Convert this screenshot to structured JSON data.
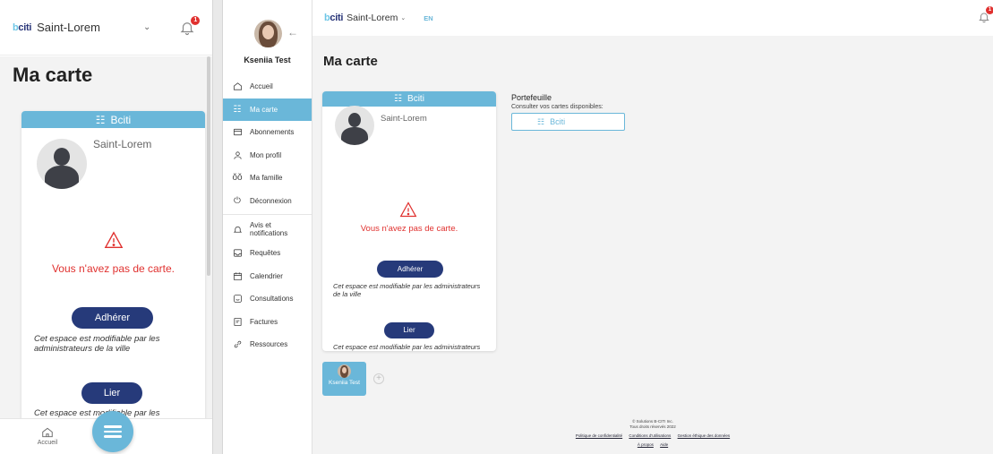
{
  "brand": {
    "logo_text_1": "b",
    "logo_text_2": "citi",
    "city": "Saint-Lorem",
    "accent": "#6ab7d9",
    "primary": "#263a7a",
    "danger": "#e0312f"
  },
  "notifications": {
    "count": "1"
  },
  "mobile": {
    "title": "Ma carte",
    "card": {
      "header": "Bciti",
      "city": "Saint-Lorem",
      "warning": "Vous n'avez pas de carte.",
      "adherer": "Adhérer",
      "note1": "Cet espace est modifiable par les administrateurs de la ville",
      "lier": "Lier",
      "note2": "Cet espace est modifiable par les administrateurs de la ville"
    },
    "footer": {
      "home": "Accueil"
    }
  },
  "desktop": {
    "topbar": {
      "city": "Saint-Lorem",
      "lang": "EN"
    },
    "user": {
      "name": "Kseniia Test"
    },
    "menu": [
      {
        "label": "Accueil",
        "icon": "home-icon"
      },
      {
        "label": "Ma carte",
        "icon": "card-icon"
      },
      {
        "label": "Abonnements",
        "icon": "subscription-icon"
      },
      {
        "label": "Mon profil",
        "icon": "person-icon"
      },
      {
        "label": "Ma famille",
        "icon": "family-icon"
      },
      {
        "label": "Déconnexion",
        "icon": "power-icon"
      },
      {
        "label": "Avis et notifications",
        "icon": "bell-icon"
      },
      {
        "label": "Requêtes",
        "icon": "inbox-icon"
      },
      {
        "label": "Calendrier",
        "icon": "calendar-icon"
      },
      {
        "label": "Consultations",
        "icon": "chat-icon"
      },
      {
        "label": "Factures",
        "icon": "invoice-icon"
      },
      {
        "label": "Ressources",
        "icon": "link-icon"
      }
    ],
    "title": "Ma carte",
    "card": {
      "header": "Bciti",
      "city": "Saint-Lorem",
      "warning": "Vous n'avez pas de carte.",
      "adherer": "Adhérer",
      "note1": "Cet espace est modifiable par les administrateurs de la ville",
      "lier": "Lier",
      "note2": "Cet espace est modifiable par les administrateurs de la ville"
    },
    "wallet": {
      "title": "Portefeuille",
      "subtitle": "Consulter vos cartes disponibles:",
      "button": "Bciti"
    },
    "member": {
      "name": "Kseniia Test",
      "add": "+"
    },
    "footer": {
      "copyright": "© Solutions B-CITI Inc.",
      "rights": "Tous droits réservés 2022",
      "links": [
        "Politique de confidentialité",
        "Conditions d'utilisations",
        "Gestion éthique des données"
      ],
      "links2": [
        "À propos",
        "Aide"
      ]
    }
  }
}
